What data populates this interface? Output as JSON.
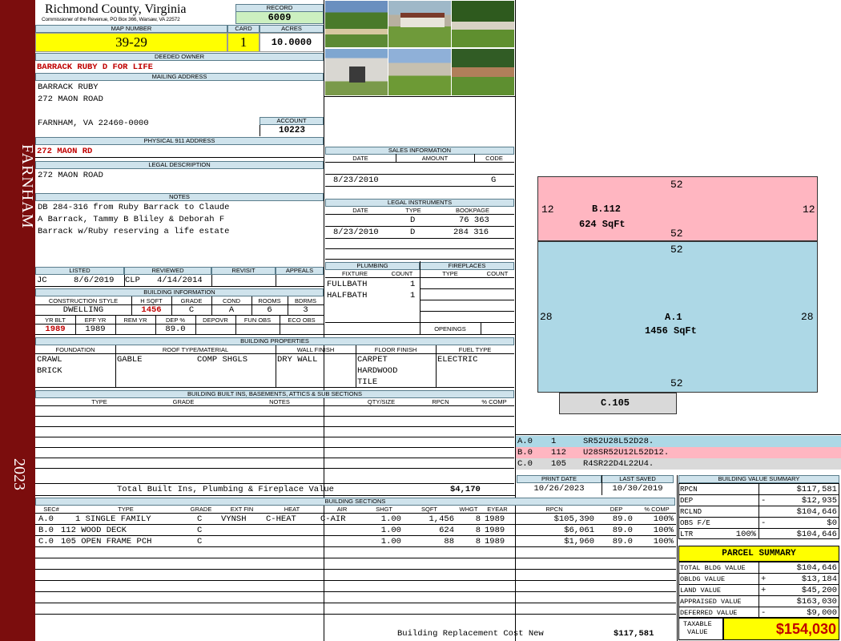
{
  "sidebar": {
    "top": "FARNHAM",
    "bottom": "2023"
  },
  "header": {
    "county": "Richmond County, Virginia",
    "commissioner": "Commissioner of the Revenue, PO Box 366, Warsaw, VA 22572",
    "record_label": "RECORD",
    "record": "6009",
    "map_label": "MAP NUMBER",
    "map": "39-29",
    "card_label": "CARD",
    "card": "1",
    "acres_label": "ACRES",
    "acres": "10.0000"
  },
  "owner": {
    "label": "DEEDED OWNER",
    "name": "BARRACK RUBY D FOR LIFE",
    "mail_label": "MAILING ADDRESS",
    "mail1": "BARRACK RUBY",
    "mail2": "272 MAON ROAD",
    "mail3": "FARNHAM, VA 22460-0000",
    "account_label": "ACCOUNT",
    "account": "10223",
    "phys_label": "PHYSICAL 911 ADDRESS",
    "phys": "272 MAON RD",
    "legal_label": "LEGAL DESCRIPTION",
    "legal": "272 MAON ROAD",
    "notes_label": "NOTES",
    "notes1": "DB 284-316 from Ruby Barrack to Claude",
    "notes2": "A Barrack, Tammy B Bliley & Deborah F",
    "notes3": "Barrack w/Ruby reserving a life estate"
  },
  "status": {
    "listed_label": "LISTED",
    "reviewed_label": "REVIEWED",
    "revisit_label": "REVISIT",
    "appeals_label": "APPEALS",
    "listed_by": "JC",
    "listed_date": "8/6/2019",
    "reviewed_by": "CLP",
    "reviewed_date": "4/14/2014"
  },
  "bi": {
    "label": "BUILDING INFORMATION",
    "h": [
      "CONSTRUCTION STYLE",
      "H SQFT",
      "GRADE",
      "COND",
      "ROOMS",
      "BDRMS"
    ],
    "style": "DWELLING",
    "hsqft": "1456",
    "grade": "C",
    "cond": "A",
    "rooms": "6",
    "bdrms": "3",
    "h2": [
      "YR BLT",
      "EFF YR",
      "REM YR",
      "DEP %",
      "DEPOVR",
      "FUN OBS",
      "ECO OBS"
    ],
    "yrblt": "1989",
    "effyr": "1989",
    "dep": "89.0"
  },
  "sales": {
    "label": "SALES INFORMATION",
    "date_h": "DATE",
    "amount_h": "AMOUNT",
    "code_h": "CODE",
    "date": "8/23/2010",
    "code": "G"
  },
  "legal_inst": {
    "label": "LEGAL INSTRUMENTS",
    "date_h": "DATE",
    "type_h": "TYPE",
    "book_h": "BOOKPAGE",
    "r1_type": "D",
    "r1_book": "76 363",
    "r2_date": "8/23/2010",
    "r2_type": "D",
    "r2_book": "284 316"
  },
  "plumb": {
    "label": "PLUMBING",
    "fixture_h": "FIXTURE",
    "count_h": "COUNT",
    "r1": "FULLBATH",
    "r1c": "1",
    "r2": "HALFBATH",
    "r2c": "1"
  },
  "fire": {
    "label": "FIREPLACES",
    "type_h": "TYPE",
    "count_h": "COUNT",
    "openings": "OPENINGS"
  },
  "props": {
    "label": "BUILDING PROPERTIES",
    "h": [
      "FOUNDATION",
      "ROOF TYPE/MATERIAL",
      "WALL FINISH",
      "FLOOR FINISH",
      "FUEL TYPE"
    ],
    "f1": "CRAWL",
    "f2": "BRICK",
    "roof1": "GABLE",
    "roof2": "COMP SHGLS",
    "wall": "DRY WALL",
    "fl1": "CARPET",
    "fl2": "HARDWOOD",
    "fl3": "TILE",
    "fuel": "ELECTRIC"
  },
  "builtins": {
    "label": "BUILDING BUILT INS, BASEMENTS, ATTICS & SUB SECTIONS",
    "h": [
      "TYPE",
      "GRADE",
      "NOTES",
      "QTY/SIZE",
      "RPCN",
      "% COMP"
    ],
    "total_label": "Total Built Ins, Plumbing & Fireplace Value",
    "total": "$4,170"
  },
  "dates": {
    "print_label": "PRINT DATE",
    "saved_label": "LAST SAVED",
    "print": "10/26/2023",
    "saved": "10/30/2019"
  },
  "sketch": {
    "b_top": "52",
    "b_left": "12",
    "b_right": "12",
    "b_name": "B.112",
    "b_area": "624 SqFt",
    "b_bottom": "52",
    "a_top": "52",
    "a_left": "28",
    "a_right": "28",
    "a_name": "A.1",
    "a_area": "1456 SqFt",
    "a_bottom": "52",
    "c_name": "C.105"
  },
  "legend": [
    {
      "id": "A.0",
      "num": "1",
      "code": "SR52U28L52D28."
    },
    {
      "id": "B.0",
      "num": "112",
      "code": "U28SR52U12L52D12."
    },
    {
      "id": "C.0",
      "num": "105",
      "code": "R4SR22D4L22U4."
    }
  ],
  "sections": {
    "label": "BUILDING SECTIONS",
    "h": [
      "SEC#",
      "TYPE",
      "GRADE",
      "EXT FIN",
      "HEAT",
      "AIR",
      "SHGT",
      "SQFT",
      "WHGT",
      "EYEAR",
      "RPCN",
      "DEP",
      "% COMP"
    ],
    "rows": [
      {
        "sec": "A.0",
        "type": "1 SINGLE FAMILY",
        "grade": "C",
        "ext": "VYNSH",
        "heat": "C-HEAT",
        "air": "C-AIR",
        "shgt": "1.00",
        "sqft": "1,456",
        "whgt": "8",
        "eyear": "1989",
        "rpcn": "$105,390",
        "dep": "89.0",
        "comp": "100%"
      },
      {
        "sec": "B.0",
        "type": "112 WOOD DECK",
        "grade": "C",
        "ext": "",
        "heat": "",
        "air": "",
        "shgt": "1.00",
        "sqft": "624",
        "whgt": "8",
        "eyear": "1989",
        "rpcn": "$6,061",
        "dep": "89.0",
        "comp": "100%"
      },
      {
        "sec": "C.0",
        "type": "105 OPEN FRAME PCH",
        "grade": "C",
        "ext": "",
        "heat": "",
        "air": "",
        "shgt": "1.00",
        "sqft": "88",
        "whgt": "8",
        "eyear": "1989",
        "rpcn": "$1,960",
        "dep": "89.0",
        "comp": "100%"
      }
    ],
    "brcn_label": "Building Replacement Cost New",
    "brcn": "$117,581"
  },
  "bvs": {
    "label": "BUILDING VALUE SUMMARY",
    "rpcn_l": "RPCN",
    "rpcn": "$117,581",
    "dep_l": "DEP",
    "dep_s": "-",
    "dep": "$12,935",
    "rclnd_l": "RCLND",
    "rclnd": "$104,646",
    "obs_l": "OBS F/E",
    "obs_s": "-",
    "obs": "$0",
    "ltr_l": "LTR",
    "ltr_pct": "100%",
    "ltr": "$104,646"
  },
  "ps": {
    "label": "PARCEL SUMMARY",
    "tbv_l": "TOTAL BLDG VALUE",
    "tbv": "$104,646",
    "ob_l": "OBLDG VALUE",
    "ob_s": "+",
    "ob": "$13,184",
    "land_l": "LAND VALUE",
    "land_s": "+",
    "land": "$45,200",
    "app_l": "APPRAISED VALUE",
    "app": "$163,030",
    "def_l": "DEFERRED VALUE",
    "def_s": "-",
    "def": "$9,000",
    "tax_l1": "TAXABLE",
    "tax_l2": "VALUE",
    "tax": "$154,030"
  },
  "colors": {
    "sidebar": "#7b0d0d",
    "label_bg": "#cfe3ec",
    "yellow": "#ffff00",
    "green": "#ccf0c0",
    "pink": "#ffb6c1",
    "blue": "#add8e6",
    "red_text": "#c00000"
  }
}
